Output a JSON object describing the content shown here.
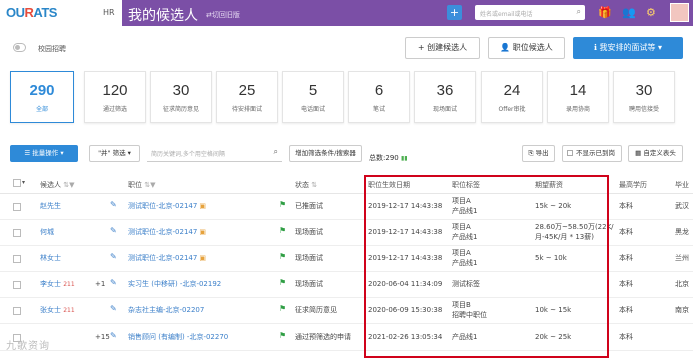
{
  "header": {
    "logo_main": "OU",
    "logo_accent": "R",
    "logo_end": "ATS",
    "hr_label": "HR",
    "title": "我的候选人",
    "switch_label": "⇄切回旧版",
    "plus": "+",
    "search_placeholder": "姓名或email或电话",
    "search_icon": "search-icon",
    "icons": [
      "gift-icon",
      "team-icon",
      "settings-icon",
      "avatar"
    ],
    "brand_color": "#7b4fa6"
  },
  "toolbar": {
    "toggle_label": "校园招聘",
    "create_candidate": "+ 创建候选人",
    "job_candidate": "👤 职位候选人",
    "my_interviews": "ℹ 我安排的面试等 ▾"
  },
  "stats": [
    {
      "num": "290",
      "label": "全部",
      "active": true
    },
    {
      "num": "120",
      "label": "通过筛选"
    },
    {
      "num": "30",
      "label": "征求简历意见"
    },
    {
      "num": "25",
      "label": "待安排面试"
    },
    {
      "num": "5",
      "label": "电话面试"
    },
    {
      "num": "6",
      "label": "笔试"
    },
    {
      "num": "36",
      "label": "现场面试"
    },
    {
      "num": "24",
      "label": "Offer审批"
    },
    {
      "num": "14",
      "label": "录用协商"
    },
    {
      "num": "30",
      "label": "聘用信接受"
    }
  ],
  "filters": {
    "batch": "☰ 批量操作 ▾",
    "and_filter": "\"并\" 筛选 ▾",
    "keyword_placeholder": "简历关键词,多个用空格间隔",
    "add_filter": "增加筛选条件/搜索器",
    "total_prefix": "总数:",
    "total": "290",
    "export": "⎘ 导出",
    "hide_rejected": "不显示已到岗",
    "custom_columns": "▦ 自定义表头"
  },
  "table": {
    "headers": [
      "候选人",
      "职位",
      "状态",
      "职位生效日期",
      "职位标签",
      "期望薪资",
      "最高学历",
      "毕业"
    ],
    "rows": [
      {
        "name": "赵先生",
        "extra": "",
        "num": "",
        "job": "测试职位-北京-02147",
        "status": "已推面试",
        "date": "2019-12-17 14:43:38",
        "tag1": "项目A",
        "tag2": "产品线1",
        "salary": "15k ~ 20k",
        "salary2": "",
        "edu": "本科",
        "grad": "武汉"
      },
      {
        "name": "何城",
        "extra": "",
        "num": "",
        "job": "测试职位-北京-02147",
        "status": "现场面试",
        "date": "2019-12-17 14:43:38",
        "tag1": "项目A",
        "tag2": "产品线1",
        "salary": "28.60万~58.50万(22K/",
        "salary2": "月-45K/月 * 13薪)",
        "edu": "本科",
        "grad": "黑龙"
      },
      {
        "name": "林女士",
        "extra": "",
        "num": "",
        "job": "测试职位-北京-02147",
        "status": "现场面试",
        "date": "2019-12-17 14:43:38",
        "tag1": "项目A",
        "tag2": "产品线1",
        "salary": "5k ~ 10k",
        "salary2": "",
        "edu": "本科",
        "grad": "兰州"
      },
      {
        "name": "李女士",
        "extra": "+1",
        "num": "211",
        "job": "实习生 (中移研) -北京-02192",
        "status": "现场面试",
        "date": "2020-06-04 11:34:09",
        "tag1": "测试标签",
        "tag2": "",
        "salary": "",
        "salary2": "",
        "edu": "本科",
        "grad": "北京"
      },
      {
        "name": "张女士",
        "extra": "",
        "num": "211",
        "job": "杂志社主编-北京-02207",
        "status": "征求简历意见",
        "date": "2020-06-09 15:30:38",
        "tag1": "项目B",
        "tag2": "招聘中职位",
        "salary": "10k ~ 15k",
        "salary2": "",
        "edu": "本科",
        "grad": "南京"
      },
      {
        "name": "",
        "extra": "+15",
        "num": "",
        "job": "销售顾问 (有编制) -北京-02270",
        "status": "通过预筛选的申请",
        "date": "2021-02-26 13:05:34",
        "tag1": "产品线1",
        "tag2": "",
        "salary": "20k ~ 25k",
        "salary2": "",
        "edu": "本科",
        "grad": ""
      }
    ]
  },
  "watermark": "九歌资询"
}
